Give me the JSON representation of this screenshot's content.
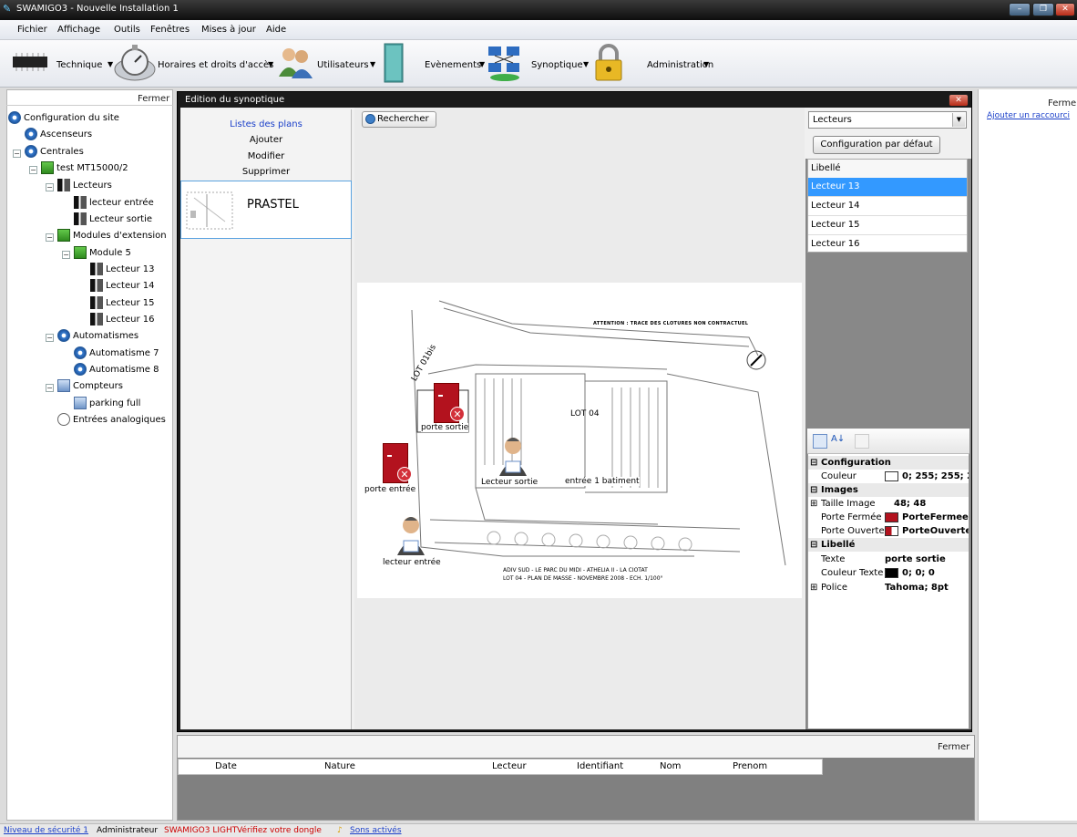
{
  "window": {
    "title": "SWAMIGO3 - Nouvelle Installation 1"
  },
  "menu": [
    "Fichier",
    "Affichage",
    "Outils",
    "Fenêtres",
    "Mises à jour",
    "Aide"
  ],
  "toolbar": {
    "technique": "Technique",
    "horaires": "Horaires et droits d'accès",
    "utilisateurs": "Utilisateurs",
    "evenements": "Evènements",
    "synoptique": "Synoptique",
    "administration": "Administration"
  },
  "left_panel": {
    "close_label": "Fermer",
    "tree": [
      "Configuration du site",
      "Ascenseurs",
      "Centrales",
      "test MT15000/2",
      "Lecteurs",
      "lecteur entrée",
      "Lecteur sortie",
      "Modules d'extension",
      "Module 5",
      "Lecteur 13",
      "Lecteur 14",
      "Lecteur 15",
      "Lecteur 16",
      "Automatismes",
      "Automatisme 7",
      "Automatisme 8",
      "Compteurs",
      "parking full",
      "Entrées analogiques"
    ]
  },
  "dialog": {
    "title": "Edition du synoptique",
    "plans": {
      "list_label": "Listes des plans",
      "add": "Ajouter",
      "modify": "Modifier",
      "delete": "Supprimer",
      "item_name": "PRASTEL"
    },
    "search_label": "Rechercher",
    "plan": {
      "note": "ATTENTION : TRACE DES CLOTURES NON CONTRACTUEL",
      "lot_label": "LOT 01bis",
      "lot04": "LOT 04",
      "footer1": "ADIV SUD - LE PARC DU MIDI - ATHELIA II - LA CIOTAT",
      "footer2": "LOT 04 - PLAN DE MASSE - NOVEMBRE 2008 - ECH. 1/100°",
      "markers": {
        "porte_sortie": "porte sortie",
        "porte_entree": "porte entrée",
        "lecteur_sortie": "Lecteur sortie",
        "entree_batiment": "entrée 1 batiment",
        "lecteur_entree": "lecteur entrée"
      }
    },
    "right": {
      "combo_value": "Lecteurs",
      "default_config": "Configuration par défaut",
      "grid_header": "Libellé",
      "readers": [
        "Lecteur 13",
        "Lecteur 14",
        "Lecteur 15",
        "Lecteur 16"
      ],
      "selected_reader": "Lecteur 13"
    },
    "properties": {
      "cat_config": "Configuration",
      "couleur_k": "Couleur",
      "couleur_v": "0; 255; 255; 2",
      "cat_images": "Images",
      "taille_k": "Taille Image",
      "taille_v": "48; 48",
      "fermee_k": "Porte Fermée",
      "fermee_v": "PorteFermee",
      "ouverte_k": "Porte Ouverte",
      "ouverte_v": "PorteOuverte",
      "cat_libelle": "Libellé",
      "texte_k": "Texte",
      "texte_v": "porte sortie",
      "ctexte_k": "Couleur Texte",
      "ctexte_v": "0; 0; 0",
      "police_k": "Police",
      "police_v": "Tahoma; 8pt"
    }
  },
  "events": {
    "close_label": "Fermer",
    "columns": [
      "Date",
      "Nature",
      "Lecteur",
      "Identifiant",
      "Nom",
      "Prenom"
    ]
  },
  "right_side": {
    "close_label": "Fermer",
    "shortcut_link": "Ajouter un raccourci"
  },
  "status": {
    "security": "Niveau de sécurité 1",
    "user": "Administrateur",
    "edition": "SWAMIGO3 LIGHT",
    "dongle": "Vérifiez votre dongle",
    "sounds": "Sons activés"
  },
  "colors": {
    "selection": "#3399ff",
    "dialog_frame": "#1a1a1a",
    "door": "#b3121e",
    "status_warn": "#cc0000",
    "link": "#0033cc"
  }
}
